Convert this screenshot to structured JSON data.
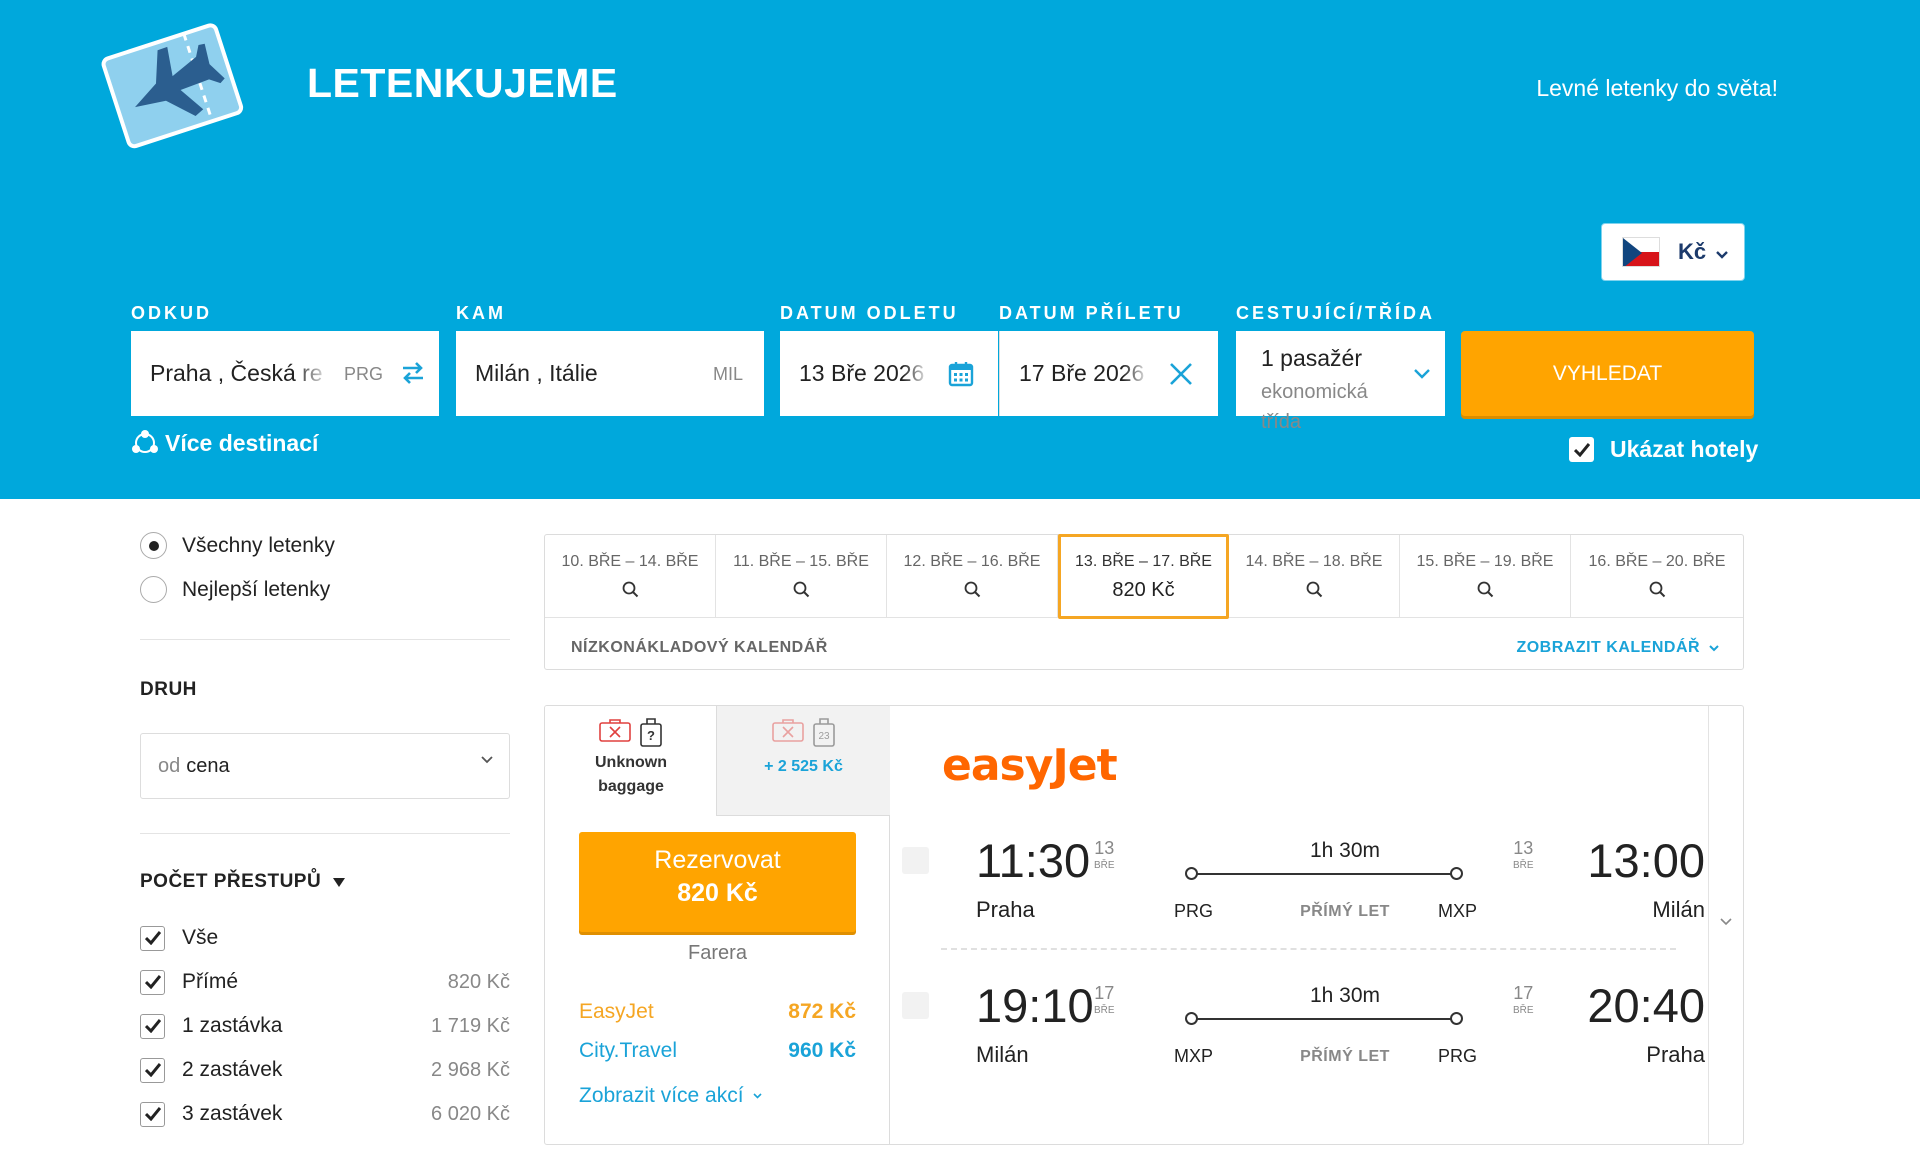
{
  "header": {
    "brand": "LETENKUJEME",
    "tagline": "Levné letenky do světa!",
    "currency": "Kč"
  },
  "search": {
    "from_label": "ODKUD",
    "from_value": "Praha , Česká re",
    "from_code": "PRG",
    "to_label": "KAM",
    "to_value": "Milán , Itálie",
    "to_code": "MIL",
    "depart_label": "DATUM ODLETU",
    "depart_value": "13 Bře 2026",
    "return_label": "DATUM PŘÍLETU",
    "return_value": "17 Bře 2026",
    "travelers_label": "CESTUJÍCÍ/TŘÍDA",
    "travelers_value": "1 pasažér",
    "class_value": "ekonomická třída",
    "search_button": "VYHLEDAT",
    "more_destinations": "Více destinací",
    "show_hotels": "Ukázat hotely",
    "show_hotels_checked": true
  },
  "filters": {
    "radio_all": "Všechny letenky",
    "radio_best": "Nejlepší letenky",
    "selected_radio": "all",
    "sort_heading": "DRUH",
    "sort_prefix": "od",
    "sort_value": "cena",
    "stops_heading": "POČET PŘESTUPŮ",
    "stops": [
      {
        "label": "Vše",
        "price": "",
        "checked": true
      },
      {
        "label": "Přímé",
        "price": "820 Kč",
        "checked": true
      },
      {
        "label": "1 zastávka",
        "price": "1 719 Kč",
        "checked": true
      },
      {
        "label": "2 zastávek",
        "price": "2 968 Kč",
        "checked": true
      },
      {
        "label": "3 zastávek",
        "price": "6 020 Kč",
        "checked": true
      }
    ]
  },
  "date_strip": {
    "cells": [
      {
        "dates": "10. BŘE – 14. BŘE",
        "price": ""
      },
      {
        "dates": "11. BŘE – 15. BŘE",
        "price": ""
      },
      {
        "dates": "12. BŘE – 16. BŘE",
        "price": ""
      },
      {
        "dates": "13. BŘE – 17. BŘE",
        "price": "820 Kč",
        "active": true
      },
      {
        "dates": "14. BŘE – 18. BŘE",
        "price": ""
      },
      {
        "dates": "15. BŘE – 19. BŘE",
        "price": ""
      },
      {
        "dates": "16. BŘE – 20. BŘE",
        "price": ""
      }
    ],
    "low_cost_label": "NÍZKONÁKLADOVÝ KALENDÁŘ",
    "show_calendar": "ZOBRAZIT KALENDÁŘ"
  },
  "result": {
    "baggage_tab1": "Unknown baggage",
    "baggage_tab2_price": "+ 2 525 Kč",
    "baggage_tab2_number": "23",
    "book_label": "Rezervovat",
    "book_price": "820 Kč",
    "seller": "Farera",
    "offers": [
      {
        "name": "EasyJet",
        "price": "872 Kč",
        "color": "#f5a623"
      },
      {
        "name": "City.Travel",
        "price": "960 Kč",
        "color": "#1aa3d8"
      }
    ],
    "more_offers": "Zobrazit více akcí",
    "airline": "easyJet",
    "legs": [
      {
        "dep_time": "11:30",
        "dep_day": "13",
        "dep_month": "BŘE",
        "dep_city": "Praha",
        "duration": "1h 30m",
        "from_code": "PRG",
        "to_code": "MXP",
        "type": "PŘÍMÝ LET",
        "arr_day": "13",
        "arr_month": "BŘE",
        "arr_time": "13:00",
        "arr_city": "Milán"
      },
      {
        "dep_time": "19:10",
        "dep_day": "17",
        "dep_month": "BŘE",
        "dep_city": "Milán",
        "duration": "1h 30m",
        "from_code": "MXP",
        "to_code": "PRG",
        "type": "PŘÍMÝ LET",
        "arr_day": "17",
        "arr_month": "BŘE",
        "arr_time": "20:40",
        "arr_city": "Praha"
      }
    ]
  },
  "colors": {
    "brand_blue": "#00a8dc",
    "accent_orange": "#ffa400",
    "link_blue": "#1aa3d8"
  }
}
